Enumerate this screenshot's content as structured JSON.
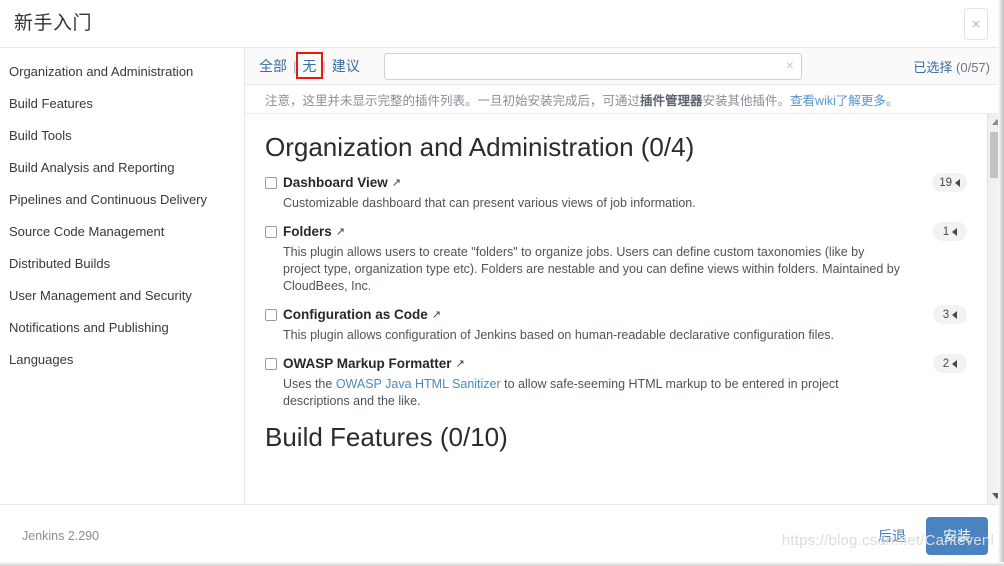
{
  "window": {
    "title": "新手入门",
    "close_icon": "close-icon",
    "close_label": "×"
  },
  "sidebar": {
    "items": [
      {
        "label": "Organization and Administration"
      },
      {
        "label": "Build Features"
      },
      {
        "label": "Build Tools"
      },
      {
        "label": "Build Analysis and Reporting"
      },
      {
        "label": "Pipelines and Continuous Delivery"
      },
      {
        "label": "Source Code Management"
      },
      {
        "label": "Distributed Builds"
      },
      {
        "label": "User Management and Security"
      },
      {
        "label": "Notifications and Publishing"
      },
      {
        "label": "Languages"
      }
    ]
  },
  "toolbar": {
    "tabs": [
      {
        "label": "全部",
        "highlighted": false
      },
      {
        "label": "无",
        "highlighted": true
      },
      {
        "label": "建议",
        "highlighted": false
      }
    ],
    "separator": "|",
    "highlight_color": "#e8190f",
    "search": {
      "value": "",
      "placeholder": "",
      "clear_icon": "×"
    },
    "selected_label": "已选择",
    "selected_count": "(0/57)"
  },
  "notice": {
    "text_1": "注意，这里并未显示完整的插件列表。一旦初始安装完成后，可通过",
    "bold_1": "插件管理器",
    "text_2": "安装其他插件。",
    "link": "查看wiki了解更多",
    "text_3": "。"
  },
  "categories": [
    {
      "title": "Organization and Administration (0/4)",
      "plugins": [
        {
          "name": "Dashboard View",
          "external_icon": "↗",
          "checked": false,
          "description": "Customizable dashboard that can present various views of job information.",
          "badge": "19"
        },
        {
          "name": "Folders",
          "external_icon": "↗",
          "checked": false,
          "description": "This plugin allows users to create \"folders\" to organize jobs. Users can define custom taxonomies (like by project type, organization type etc). Folders are nestable and you can define views within folders. Maintained by CloudBees, Inc.",
          "badge": "1"
        },
        {
          "name": "Configuration as Code",
          "external_icon": "↗",
          "checked": false,
          "description": "This plugin allows configuration of Jenkins based on human-readable declarative configuration files.",
          "badge": "3"
        },
        {
          "name": "OWASP Markup Formatter",
          "external_icon": "↗",
          "checked": false,
          "description_pre": "Uses the ",
          "description_link": "OWASP Java HTML Sanitizer",
          "description_post": " to allow safe-seeming HTML markup to be entered in project descriptions and the like.",
          "badge": "2"
        }
      ]
    },
    {
      "title": "Build Features (0/10)",
      "plugins": []
    }
  ],
  "scrollbar": {
    "up_icon": "chevron-up-icon",
    "down_icon": "chevron-down-icon"
  },
  "footer": {
    "version": "Jenkins 2.290",
    "back_label": "后退",
    "install_label": "安装",
    "install_color": "#4b83c0"
  },
  "watermark": "https://blog.csdn.net/Cantevenl"
}
